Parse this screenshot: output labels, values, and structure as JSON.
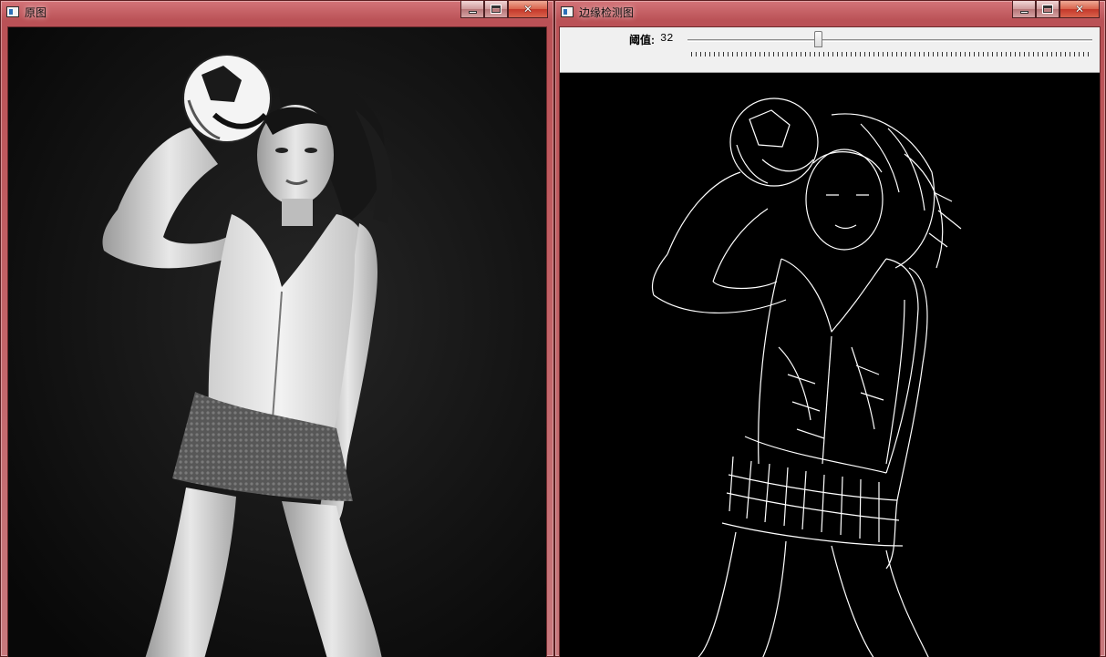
{
  "windows": [
    {
      "title": "原图",
      "buttons": {
        "minimize": "minimize",
        "maximize": "maximize",
        "close": "close"
      }
    },
    {
      "title": "边缘检测图",
      "trackbar": {
        "label": "阈值:",
        "value": "32",
        "level_fraction": 0.32
      },
      "buttons": {
        "minimize": "minimize",
        "maximize": "maximize",
        "close": "close"
      }
    }
  ],
  "icons": {
    "app": "app-window-icon",
    "min": "minimize-icon",
    "max": "maximize-icon",
    "close": "close-icon"
  },
  "colors": {
    "titlebar": "#c0646a",
    "edge_stroke": "#ffffff",
    "background": "#000000"
  }
}
